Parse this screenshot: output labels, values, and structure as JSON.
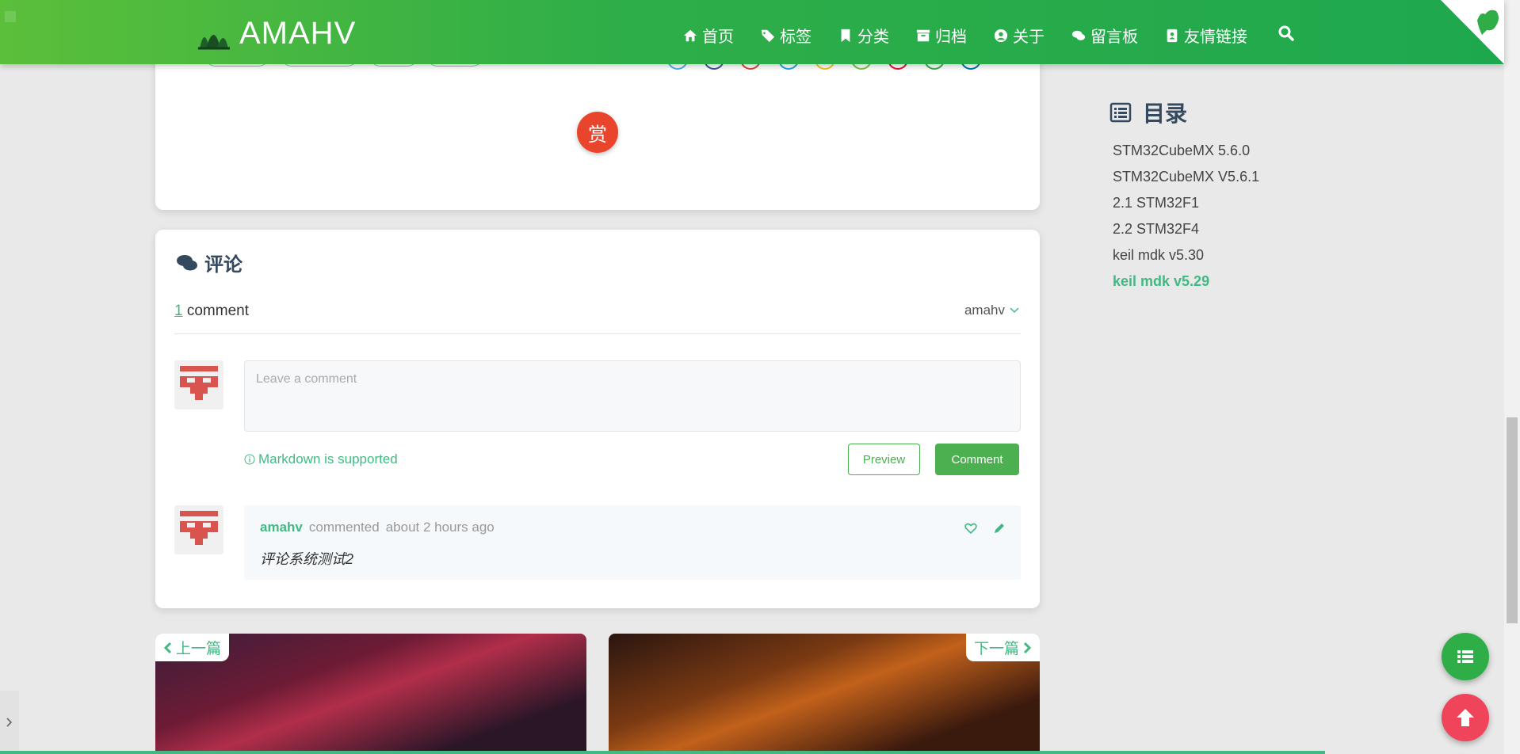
{
  "brand": {
    "name": "AMAHV"
  },
  "nav": {
    "items": [
      {
        "label": "首页",
        "icon": "home-icon"
      },
      {
        "label": "标签",
        "icon": "tags-icon"
      },
      {
        "label": "分类",
        "icon": "bookmark-icon"
      },
      {
        "label": "归档",
        "icon": "archive-icon"
      },
      {
        "label": "关于",
        "icon": "user-circle-icon"
      },
      {
        "label": "留言板",
        "icon": "comments-icon"
      },
      {
        "label": "友情链接",
        "icon": "address-book-icon"
      }
    ]
  },
  "reward": {
    "label": "赏"
  },
  "comments": {
    "title": "评论",
    "count": "1",
    "count_suffix": " comment",
    "user": "amahv",
    "placeholder": "Leave a comment",
    "markdown_hint": "Markdown is supported",
    "preview_label": "Preview",
    "comment_label": "Comment",
    "items": [
      {
        "user": "amahv",
        "action": "commented",
        "time": "about 2 hours ago",
        "body": "评论系统测试2"
      }
    ]
  },
  "post_nav": {
    "prev": "上一篇",
    "next": "下一篇"
  },
  "toc": {
    "title": "目录",
    "items": [
      "STM32CubeMX 5.6.0",
      "STM32CubeMX V5.6.1",
      "2.1 STM32F1",
      "2.2 STM32F4",
      "keil mdk v5.30",
      "keil mdk v5.29"
    ],
    "active_index": 5
  },
  "colors": {
    "accent": "#42b983",
    "nav_gradient_start": "#5bbf3a",
    "nav_gradient_end": "#1ea84e",
    "reward": "#e8452c",
    "back_to_top": "#f0445a"
  }
}
